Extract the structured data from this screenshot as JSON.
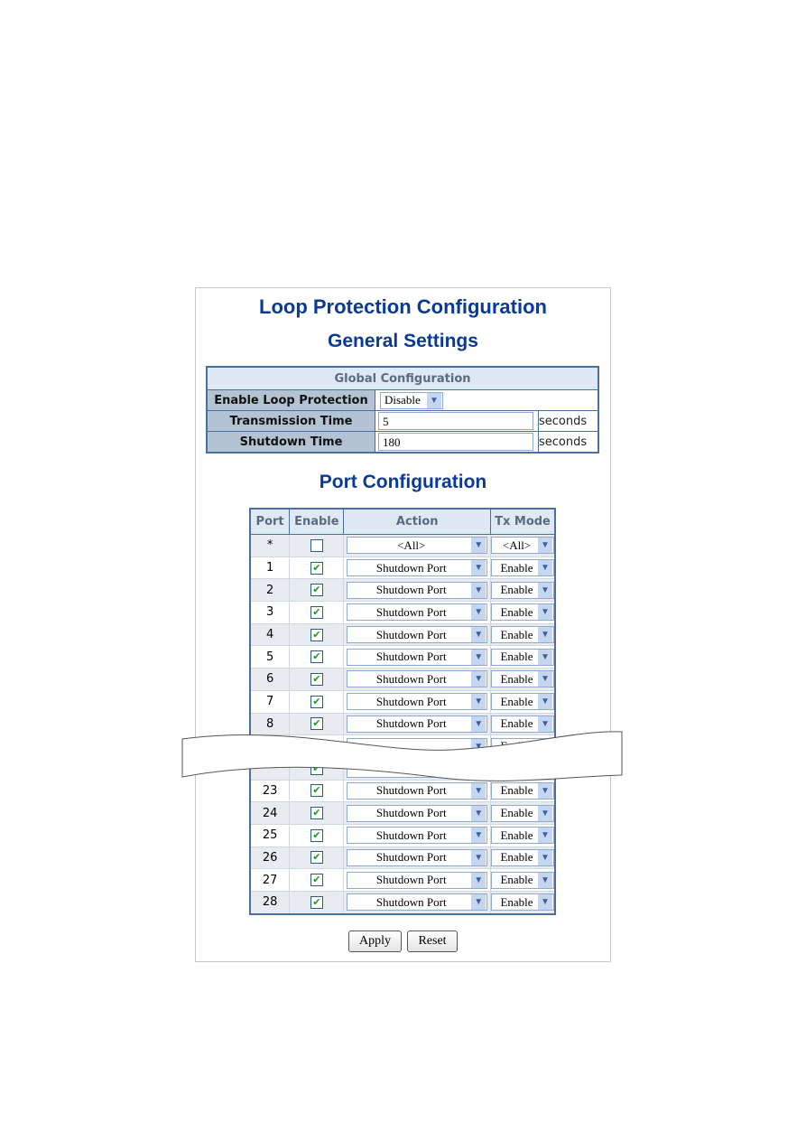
{
  "title": "Loop Protection Configuration",
  "general": {
    "title": "General Settings",
    "header": "Global Configuration",
    "rows": [
      {
        "label": "Enable Loop Protection",
        "value": "Disable"
      },
      {
        "label": "Transmission Time",
        "value": "5",
        "unit": "seconds"
      },
      {
        "label": "Shutdown Time",
        "value": "180",
        "unit": "seconds"
      }
    ]
  },
  "port": {
    "title": "Port Configuration",
    "columns": [
      "Port",
      "Enable",
      "Action",
      "Tx Mode"
    ],
    "rows": [
      {
        "port": "*",
        "enable": false,
        "action": "<All>",
        "tx": "<All>"
      },
      {
        "port": "1",
        "enable": true,
        "action": "Shutdown Port",
        "tx": "Enable"
      },
      {
        "port": "2",
        "enable": true,
        "action": "Shutdown Port",
        "tx": "Enable"
      },
      {
        "port": "3",
        "enable": true,
        "action": "Shutdown Port",
        "tx": "Enable"
      },
      {
        "port": "4",
        "enable": true,
        "action": "Shutdown Port",
        "tx": "Enable"
      },
      {
        "port": "5",
        "enable": true,
        "action": "Shutdown Port",
        "tx": "Enable"
      },
      {
        "port": "6",
        "enable": true,
        "action": "Shutdown Port",
        "tx": "Enable"
      },
      {
        "port": "7",
        "enable": true,
        "action": "Shutdown Port",
        "tx": "Enable"
      },
      {
        "port": "8",
        "enable": true,
        "action": "Shutdown Port",
        "tx": "Enable"
      },
      {
        "port": "",
        "enable": true,
        "action": "",
        "tx": "Enable"
      },
      {
        "port": "",
        "enable": true,
        "action": "",
        "tx": ""
      },
      {
        "port": "23",
        "enable": true,
        "action": "Shutdown Port",
        "tx": "Enable"
      },
      {
        "port": "24",
        "enable": true,
        "action": "Shutdown Port",
        "tx": "Enable"
      },
      {
        "port": "25",
        "enable": true,
        "action": "Shutdown Port",
        "tx": "Enable"
      },
      {
        "port": "26",
        "enable": true,
        "action": "Shutdown Port",
        "tx": "Enable"
      },
      {
        "port": "27",
        "enable": true,
        "action": "Shutdown Port",
        "tx": "Enable"
      },
      {
        "port": "28",
        "enable": true,
        "action": "Shutdown Port",
        "tx": "Enable"
      }
    ]
  },
  "buttons": {
    "apply": "Apply",
    "reset": "Reset"
  },
  "colors": {
    "title": "#0b3a96",
    "border": "#4a6fa0",
    "label_bg": "#b4c3d3"
  }
}
